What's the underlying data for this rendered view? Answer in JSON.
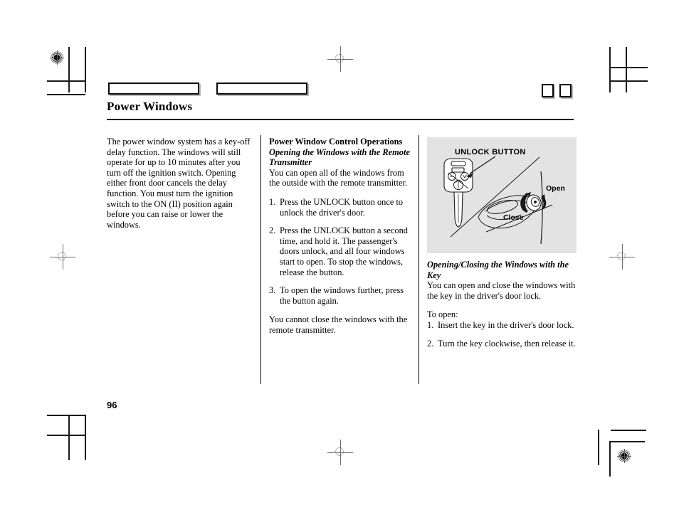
{
  "document": {
    "title": "Power Windows",
    "page_number": "96",
    "header_tabs": [
      "",
      ""
    ],
    "corner_markers": [
      "",
      ""
    ]
  },
  "columns": {
    "left": {
      "body": "The power window system has a key-off delay function. The windows will still operate for up to 10 minutes after you turn off the ignition switch. Opening either front door cancels the delay function. You must turn the ignition switch to the ON (II) position again before you can raise or lower the windows."
    },
    "middle": {
      "heading": "Power Window Control Operations",
      "subheading": "Opening the Windows with the Remote Transmitter",
      "intro": "You can open all of the windows from the outside with the remote transmitter.",
      "steps": [
        {
          "num": "1.",
          "text": "Press the UNLOCK button once to unlock the driver's door."
        },
        {
          "num": "2.",
          "text": "Press the UNLOCK button a second time, and hold it. The passenger's doors unlock, and all four windows start to open. To stop the windows, release the button."
        },
        {
          "num": "3.",
          "text": "To open the windows further, press the button again."
        }
      ],
      "closing": "You cannot close the windows with the remote transmitter."
    },
    "right": {
      "subheading": "Opening/Closing the Windows with the Key",
      "intro": "You can open and close the windows with the key in the driver's door lock.",
      "to_open_label": "To open:",
      "steps": [
        {
          "num": "1.",
          "text": "Insert the key in the driver's door lock."
        },
        {
          "num": "2.",
          "text": "Turn the key clockwise, then release it."
        }
      ]
    }
  },
  "illustration": {
    "callout": "UNLOCK BUTTON",
    "label_open": "Open",
    "label_close": "Close",
    "background_color": "#e3e3e3",
    "line_color": "#1a1a1a"
  }
}
